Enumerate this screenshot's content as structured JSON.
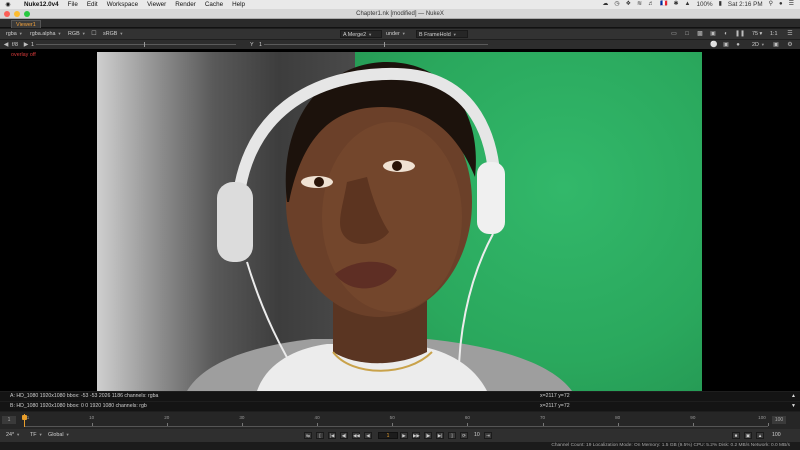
{
  "menubar": {
    "app_name": "Nuke12.0v4",
    "items": [
      "File",
      "Edit",
      "Workspace",
      "Viewer",
      "Render",
      "Cache",
      "Help"
    ],
    "status": {
      "battery": "100%",
      "clock": "Sat 2:16 PM",
      "flag": "🇫🇷"
    }
  },
  "window": {
    "title": "Chapter1.nk [modified] — NukeX"
  },
  "tabs": [
    {
      "label": "Viewer1"
    }
  ],
  "toolbar1": {
    "channels": "rgba",
    "alpha": "rgba.alpha",
    "colorspace_display": "RGB",
    "lut": "sRGB",
    "input_a": "A  Merge2",
    "composite_mode": "under",
    "input_b": "B  FrameHold",
    "zoom": "75 ▾",
    "proxy": "1:1"
  },
  "toolbar2": {
    "fstop": "f/8",
    "gain": "1",
    "gamma_label": "Y",
    "gamma": "1",
    "view_mode": "2D"
  },
  "viewer": {
    "overlay_label": "overlay off"
  },
  "info": {
    "line_a": "A:  HD_1080 1920x1080  bbox: -53 -53 2026 1186 channels: rgba",
    "line_b": "B:  HD_1080 1920x1080  bbox: 0 0 1920 1080 channels: rgb",
    "coords_a": "x=2117 y=72",
    "coords_b": "x=2117 y=72"
  },
  "timeline": {
    "start": "1",
    "end": "100",
    "ticks": [
      "1",
      "10",
      "20",
      "30",
      "40",
      "50",
      "60",
      "70",
      "80",
      "90",
      "100"
    ],
    "current_frame": 1
  },
  "transport": {
    "fps": "24*",
    "timecode": "TF",
    "range": "Global",
    "frame": "1",
    "increment": "10",
    "end_frame": "100"
  },
  "statusbar": {
    "text": "Channel Count: 19  Localization Mode: On  Memory: 1.5 GB (9.5%)  CPU: 5.2%  Disk: 0.2 MB/s  Network: 0.0 MB/s"
  },
  "colors": {
    "accent": "#e89e2b",
    "greenscreen": "#2db266",
    "overlay_text": "#d83b3b"
  }
}
